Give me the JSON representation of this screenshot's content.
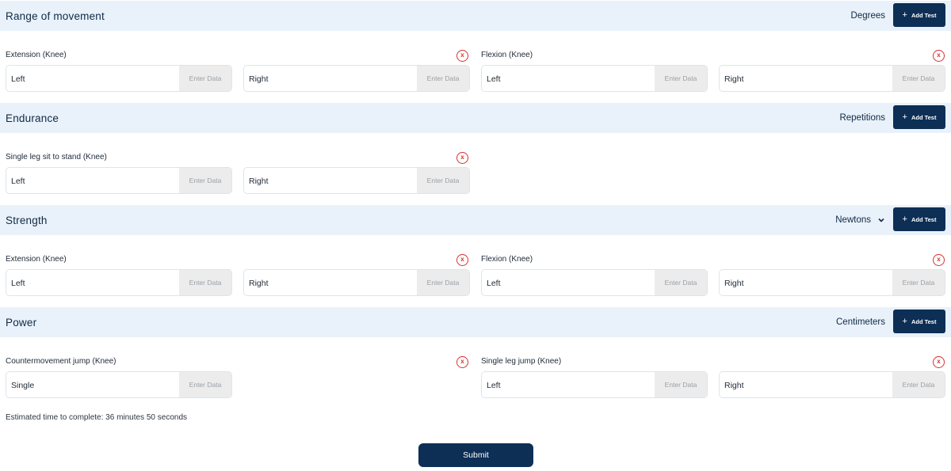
{
  "sections": [
    {
      "title": "Range of movement",
      "unit": "Degrees",
      "add_label": "Add Test",
      "tests": [
        {
          "name": "Extension (Knee)",
          "fields": [
            {
              "label": "Left",
              "placeholder": "Enter Data"
            },
            {
              "label": "Right",
              "placeholder": "Enter Data"
            }
          ]
        },
        {
          "name": "Flexion (Knee)",
          "fields": [
            {
              "label": "Left",
              "placeholder": "Enter Data"
            },
            {
              "label": "Right",
              "placeholder": "Enter Data"
            }
          ]
        }
      ]
    },
    {
      "title": "Endurance",
      "unit": "Repetitions",
      "add_label": "Add Test",
      "tests": [
        {
          "name": "Single leg sit to stand (Knee)",
          "fields": [
            {
              "label": "Left",
              "placeholder": "Enter Data"
            },
            {
              "label": "Right",
              "placeholder": "Enter Data"
            }
          ]
        }
      ]
    },
    {
      "title": "Strength",
      "unit": "Newtons",
      "unit_icon": "chevron-down-icon",
      "add_label": "Add Test",
      "tests": [
        {
          "name": "Extension (Knee)",
          "fields": [
            {
              "label": "Left",
              "placeholder": "Enter Data"
            },
            {
              "label": "Right",
              "placeholder": "Enter Data"
            }
          ]
        },
        {
          "name": "Flexion (Knee)",
          "fields": [
            {
              "label": "Left",
              "placeholder": "Enter Data"
            },
            {
              "label": "Right",
              "placeholder": "Enter Data"
            }
          ]
        }
      ]
    },
    {
      "title": "Power",
      "unit": "Centimeters",
      "add_label": "Add Test",
      "tests": [
        {
          "name": "Countermovement jump (Knee)",
          "fields": [
            {
              "label": "Single",
              "placeholder": "Enter Data"
            }
          ]
        },
        {
          "name": "Single leg jump (Knee)",
          "fields": [
            {
              "label": "Left",
              "placeholder": "Enter Data"
            },
            {
              "label": "Right",
              "placeholder": "Enter Data"
            }
          ]
        }
      ]
    }
  ],
  "remove_icon_glyph": "x",
  "add_icon_glyph": "+",
  "estimate": "Estimated time to complete: 36 minutes 50 seconds",
  "submit_label": "Submit",
  "colors": {
    "accent": "#0d2f55",
    "section_bg": "#e9f1fa",
    "remove_red": "#d93030",
    "input_bg": "#ececec"
  }
}
